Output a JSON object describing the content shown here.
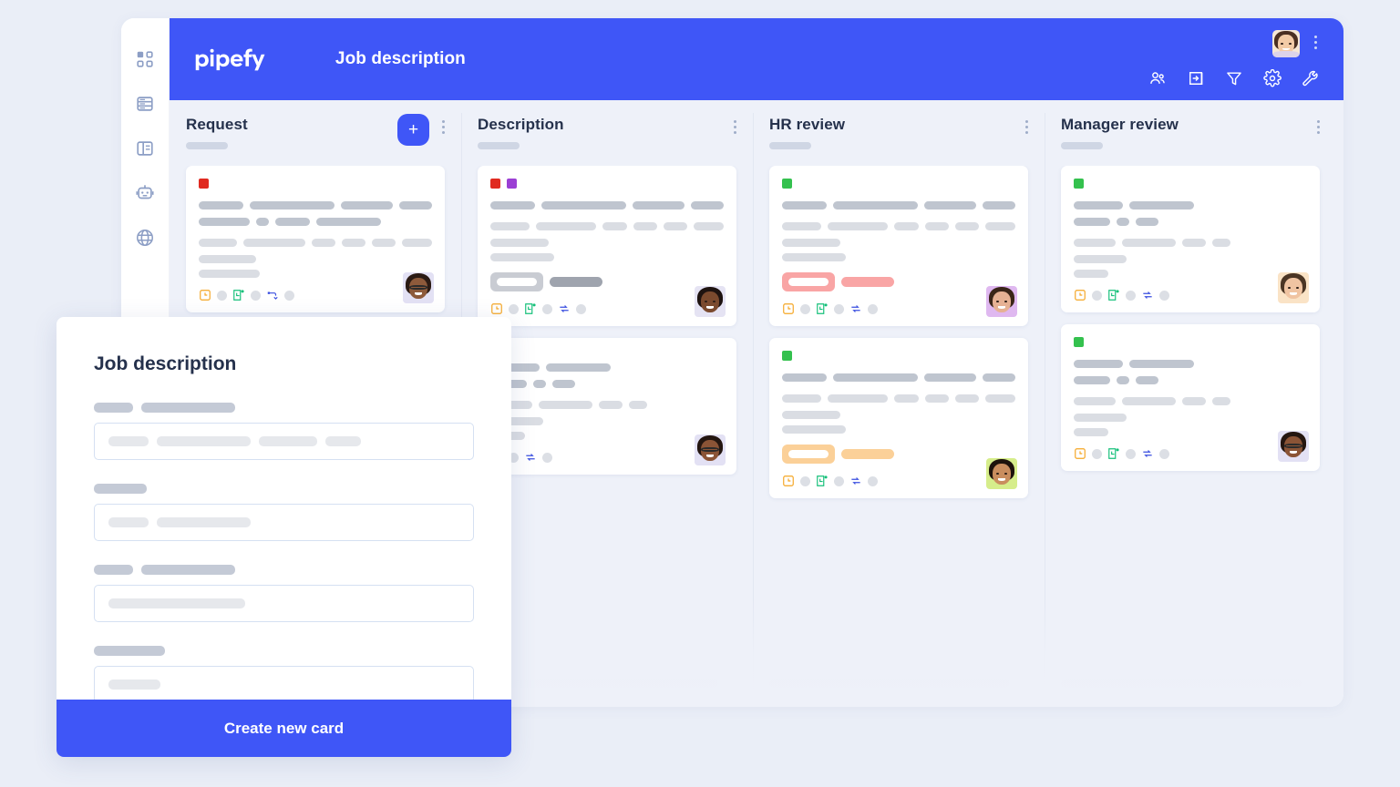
{
  "app": {
    "logo_text": "pipefy",
    "board_title": "Job description"
  },
  "sidebar": {
    "items": [
      {
        "icon": "apps-grid-icon",
        "name": "sidebar-item-apps"
      },
      {
        "icon": "database-icon",
        "name": "sidebar-item-database"
      },
      {
        "icon": "layout-panel-icon",
        "name": "sidebar-item-layout"
      },
      {
        "icon": "robot-icon",
        "name": "sidebar-item-automation"
      },
      {
        "icon": "globe-icon",
        "name": "sidebar-item-portal"
      }
    ]
  },
  "header": {
    "icons": [
      {
        "icon": "members-icon",
        "name": "header-members-button"
      },
      {
        "icon": "inbox-import-icon",
        "name": "header-import-button"
      },
      {
        "icon": "filter-funnel-icon",
        "name": "header-filter-button"
      },
      {
        "icon": "gear-icon",
        "name": "header-settings-button"
      },
      {
        "icon": "wrench-icon",
        "name": "header-tools-button"
      }
    ],
    "avatar_alt": "user-avatar",
    "kebab_label": "more-options"
  },
  "board": {
    "columns": [
      {
        "title": "Request",
        "has_add_button": true,
        "add_label": "+",
        "cards": [
          {
            "chips": [
              "#e02a20"
            ],
            "highlight": null,
            "footer_icons": [
              "clock-icon",
              "calendar-check-icon",
              "flow-connect-icon"
            ],
            "avatar": "card-avatar"
          }
        ]
      },
      {
        "title": "Description",
        "has_add_button": false,
        "cards": [
          {
            "chips": [
              "#e02a20",
              "#9b3fd4"
            ],
            "highlight": "#c9ccd3",
            "footer_icons": [
              "clock-icon",
              "calendar-check-icon",
              "refresh-cycle-icon"
            ],
            "avatar": "card-avatar"
          },
          {
            "chips": [],
            "highlight": null,
            "footer_icons": [
              "calendar-check-icon",
              "refresh-cycle-icon"
            ],
            "avatar": "card-avatar"
          }
        ]
      },
      {
        "title": "HR review",
        "has_add_button": false,
        "cards": [
          {
            "chips": [
              "#34c14e"
            ],
            "highlight": "#f9a5a5",
            "footer_icons": [
              "clock-icon",
              "calendar-check-icon",
              "refresh-cycle-icon"
            ],
            "avatar": "card-avatar"
          },
          {
            "chips": [
              "#34c14e"
            ],
            "highlight": "#fbd098",
            "footer_icons": [
              "clock-icon",
              "calendar-check-icon",
              "refresh-cycle-icon"
            ],
            "avatar": "card-avatar"
          }
        ]
      },
      {
        "title": "Manager review",
        "has_add_button": false,
        "cards": [
          {
            "chips": [
              "#34c14e"
            ],
            "highlight": null,
            "footer_icons": [
              "clock-icon",
              "calendar-check-icon",
              "refresh-cycle-icon"
            ],
            "avatar": "card-avatar"
          },
          {
            "chips": [
              "#34c14e"
            ],
            "highlight": null,
            "footer_icons": [
              "clock-icon",
              "calendar-check-icon",
              "refresh-cycle-icon"
            ],
            "avatar": "card-avatar"
          }
        ]
      }
    ]
  },
  "modal": {
    "title": "Job description",
    "fields": [
      {
        "label_parts": 2,
        "value_parts": 4
      },
      {
        "label_parts": 1,
        "value_parts": 2
      },
      {
        "label_parts": 2,
        "value_parts": 1
      },
      {
        "label_parts": 1,
        "value_parts": 1
      }
    ],
    "cta_label": "Create new card"
  },
  "colors": {
    "brand_blue": "#3f56f7",
    "board_bg": "#eef1f9",
    "page_bg": "#eaeef7",
    "text_dark": "#25314c",
    "chip_red": "#e02a20",
    "chip_purple": "#9b3fd4",
    "chip_green": "#34c14e",
    "highlight_pink": "#f9a5a5",
    "highlight_orange": "#fbd098",
    "icon_orange": "#f5a623",
    "icon_green": "#15c07a",
    "icon_blue": "#3a4fe0"
  }
}
